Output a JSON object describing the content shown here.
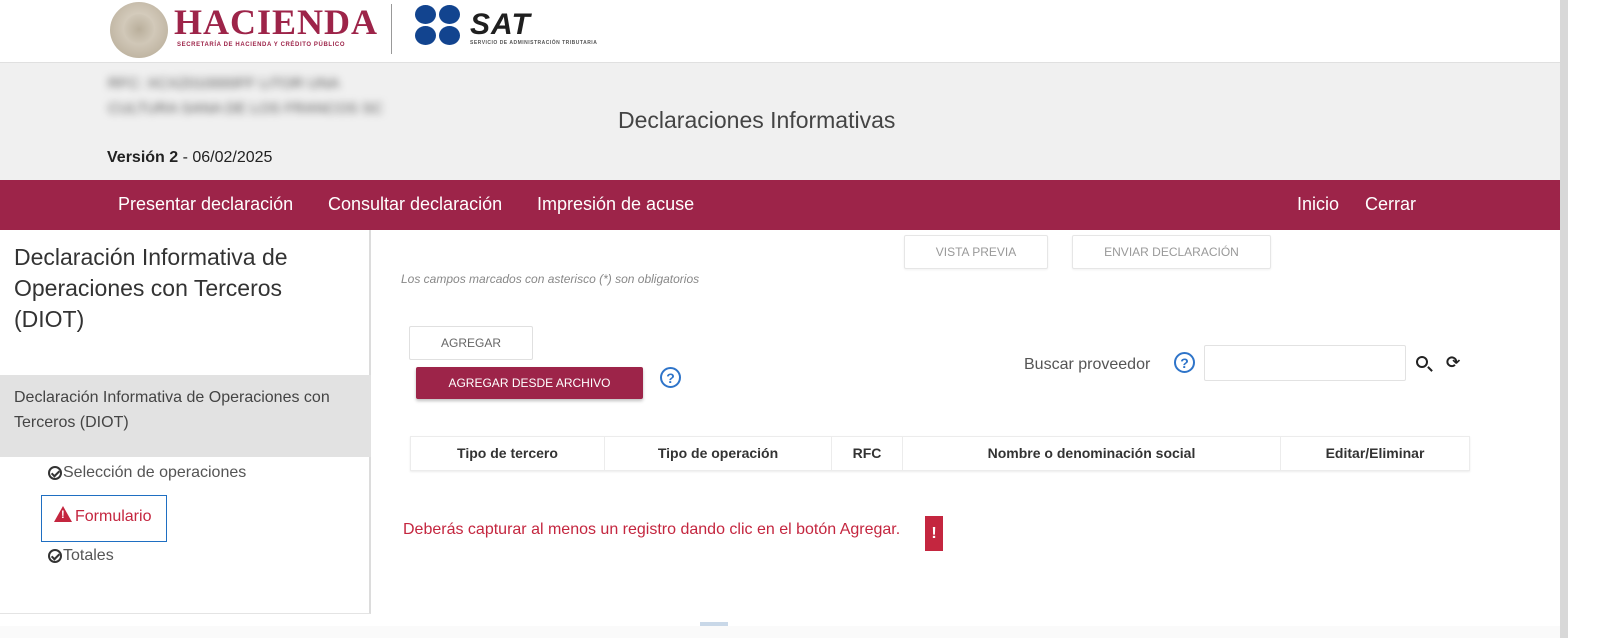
{
  "logos": {
    "hacienda_title": "HACIENDA",
    "hacienda_subtitle": "SECRETARÍA DE HACIENDA Y CRÉDITO PÚBLICO",
    "sat_title": "SAT",
    "sat_subtitle": "SERVICIO DE ADMINISTRACIÓN TRIBUTARIA"
  },
  "header": {
    "taxpayer_info_blurred": "RFC: XCXZ010000FF LITOR UNA CULTURA SANA DE LOS FRANCOS SC",
    "version_label": "Versión 2",
    "version_date": " - 06/02/2025",
    "title": "Declaraciones Informativas"
  },
  "nav": {
    "items": [
      "Presentar declaración",
      "Consultar declaración",
      "Impresión de acuse"
    ],
    "right_items": [
      "Inicio",
      "Cerrar"
    ]
  },
  "sidebar": {
    "title": "Declaración Informativa de Operaciones con Terceros (DIOT)",
    "section": "Declaración Informativa de Operaciones con Terceros (DIOT)",
    "items": [
      "Selección de operaciones",
      "Formulario",
      "Totales"
    ]
  },
  "main": {
    "preview_button": "VISTA PREVIA",
    "send_button": "ENVIAR DECLARACIÓN",
    "required_note": "Los campos marcados con asterisco (*) son obligatorios",
    "add_button": "AGREGAR",
    "add_file_button": "AGREGAR DESDE ARCHIVO",
    "help_glyph": "?",
    "search_label": "Buscar proveedor",
    "search_value": "",
    "refresh_glyph": "⟳",
    "table_headers": [
      "Tipo de tercero",
      "Tipo de operación",
      "RFC",
      "Nombre o denominación social",
      "Editar/Eliminar"
    ],
    "error_message": "Deberás capturar al menos un registro dando clic en el botón Agregar.",
    "error_badge": "!"
  },
  "colors": {
    "brand_maroon": "#9d2449",
    "error_red": "#c4263f",
    "help_blue": "#2e74c9",
    "sat_blue": "#12448f"
  }
}
